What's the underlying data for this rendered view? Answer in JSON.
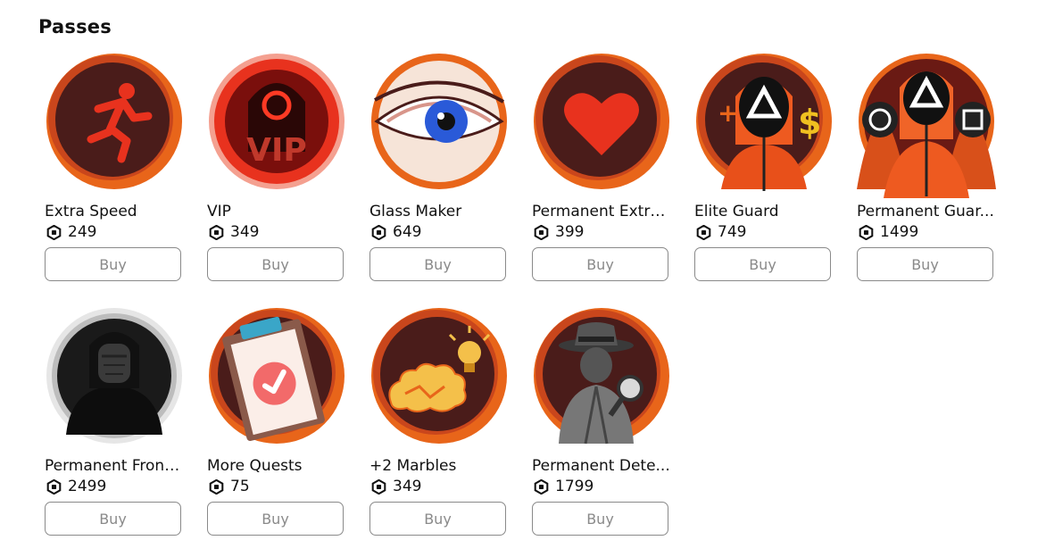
{
  "section": {
    "title": "Passes"
  },
  "currency_icon": "robux-icon",
  "passes": [
    {
      "name": "Extra Speed",
      "price": "249",
      "button": "Buy",
      "icon": "running-man-icon"
    },
    {
      "name": "VIP",
      "price": "349",
      "button": "Buy",
      "icon": "vip-guard-icon"
    },
    {
      "name": "Glass Maker",
      "price": "649",
      "button": "Buy",
      "icon": "eye-icon"
    },
    {
      "name": "Permanent Extra...",
      "price": "399",
      "button": "Buy",
      "icon": "heart-icon"
    },
    {
      "name": "Elite Guard",
      "price": "749",
      "button": "Buy",
      "icon": "triangle-guard-icon"
    },
    {
      "name": "Permanent Guar...",
      "price": "1499",
      "button": "Buy",
      "icon": "guard-trio-icon"
    },
    {
      "name": "Permanent Front...",
      "price": "2499",
      "button": "Buy",
      "icon": "frontman-mask-icon"
    },
    {
      "name": "More Quests",
      "price": "75",
      "button": "Buy",
      "icon": "clipboard-check-icon"
    },
    {
      "name": "+2 Marbles",
      "price": "349",
      "button": "Buy",
      "icon": "brain-lightbulb-icon"
    },
    {
      "name": "Permanent Dete...",
      "price": "1799",
      "button": "Buy",
      "icon": "detective-icon"
    }
  ],
  "colors": {
    "badge_bg": "#4a1c1a",
    "badge_ring": "#e8651a",
    "accent_red": "#e8321e",
    "button_border": "#8a8a8a"
  }
}
